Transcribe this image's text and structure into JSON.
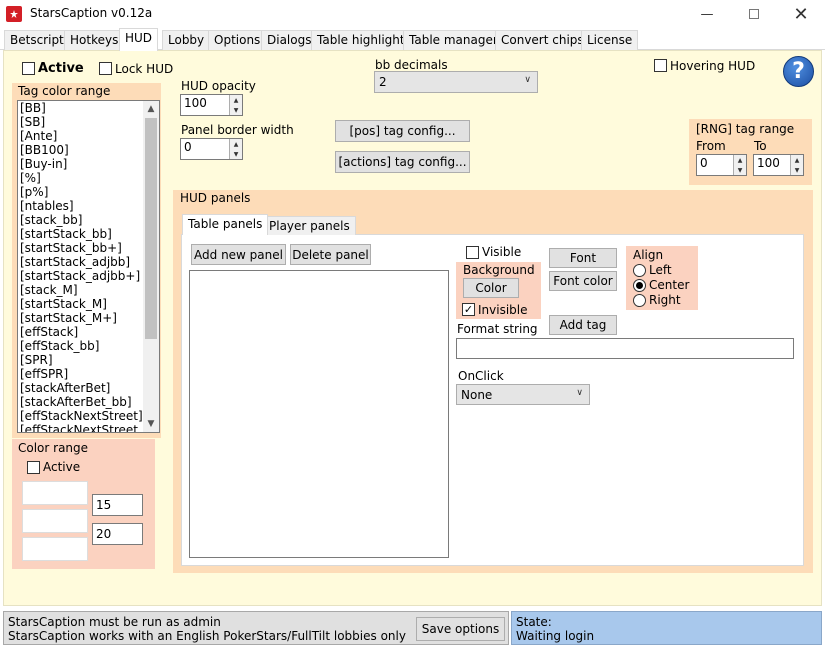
{
  "window": {
    "title": "StarsCaption v0.12a",
    "minimize_icon": "minimize-icon",
    "maximize_icon": "maximize-icon",
    "close_icon": "close-icon"
  },
  "tabs": [
    {
      "label": "Betscript"
    },
    {
      "label": "Hotkeys"
    },
    {
      "label": "HUD"
    },
    {
      "label": "Lobby"
    },
    {
      "label": "Options"
    },
    {
      "label": "Dialogs"
    },
    {
      "label": "Table highlight"
    },
    {
      "label": "Table manager"
    },
    {
      "label": "Convert chips"
    },
    {
      "label": "License"
    }
  ],
  "hud": {
    "active_label": "Active",
    "active_checked": false,
    "lock_hud_label": "Lock HUD",
    "lock_hud_checked": false,
    "hovering_hud_label": "Hovering HUD",
    "hovering_hud_checked": false,
    "tag_color_range_label": "Tag color range",
    "tags": [
      "[BB]",
      "[SB]",
      "[Ante]",
      "[BB100]",
      "[Buy-in]",
      "[%]",
      "[p%]",
      "[ntables]",
      "[stack_bb]",
      "[startStack_bb]",
      "[startStack_bb+]",
      "[startStack_adjbb]",
      "[startStack_adjbb+]",
      "[stack_M]",
      "[startStack_M]",
      "[startStack_M+]",
      "[effStack]",
      "[effStack_bb]",
      "[SPR]",
      "[effSPR]",
      "[stackAfterBet]",
      "[stackAfterBet_bb]",
      "[effStackNextStreet]",
      "[effStackNextStreet_b"
    ],
    "color_range": {
      "label": "Color range",
      "active_label": "Active",
      "active_checked": false,
      "value1": "15",
      "value2": "20"
    },
    "hud_opacity_label": "HUD opacity",
    "hud_opacity_value": "100",
    "panel_border_width_label": "Panel border width",
    "panel_border_width_value": "0",
    "bb_decimals_label": "bb decimals",
    "bb_decimals_value": "2",
    "pos_tag_config_label": "[pos] tag config...",
    "actions_tag_config_label": "[actions] tag config...",
    "rng": {
      "label": "[RNG] tag range",
      "from_label": "From",
      "from_value": "0",
      "to_label": "To",
      "to_value": "100"
    },
    "hud_panels_label": "HUD panels",
    "panel_tabs": [
      {
        "label": "Table panels"
      },
      {
        "label": "Player panels"
      }
    ],
    "add_new_panel_label": "Add new panel",
    "delete_panel_label": "Delete panel",
    "visible_label": "Visible",
    "visible_checked": false,
    "background_label": "Background",
    "color_button_label": "Color",
    "invisible_label": "Invisible",
    "invisible_checked": true,
    "font_button_label": "Font",
    "font_color_button_label": "Font color",
    "add_tag_button_label": "Add tag",
    "align": {
      "label": "Align",
      "options": [
        "Left",
        "Center",
        "Right"
      ],
      "selected": "Center"
    },
    "format_string_label": "Format string",
    "format_string_value": "",
    "onclick_label": "OnClick",
    "onclick_value": "None"
  },
  "status": {
    "line1": "StarsCaption must be run as admin",
    "line2": "StarsCaption works with an English PokerStars/FullTilt lobbies only",
    "save_options_label": "Save options",
    "state_label": "State:",
    "state_value": "Waiting login"
  },
  "colors": {
    "content_bg": "#fffbdc",
    "peach": "#fddcb8",
    "salmon": "#fbd2c0",
    "status_right_bg": "#a8c8ec"
  }
}
